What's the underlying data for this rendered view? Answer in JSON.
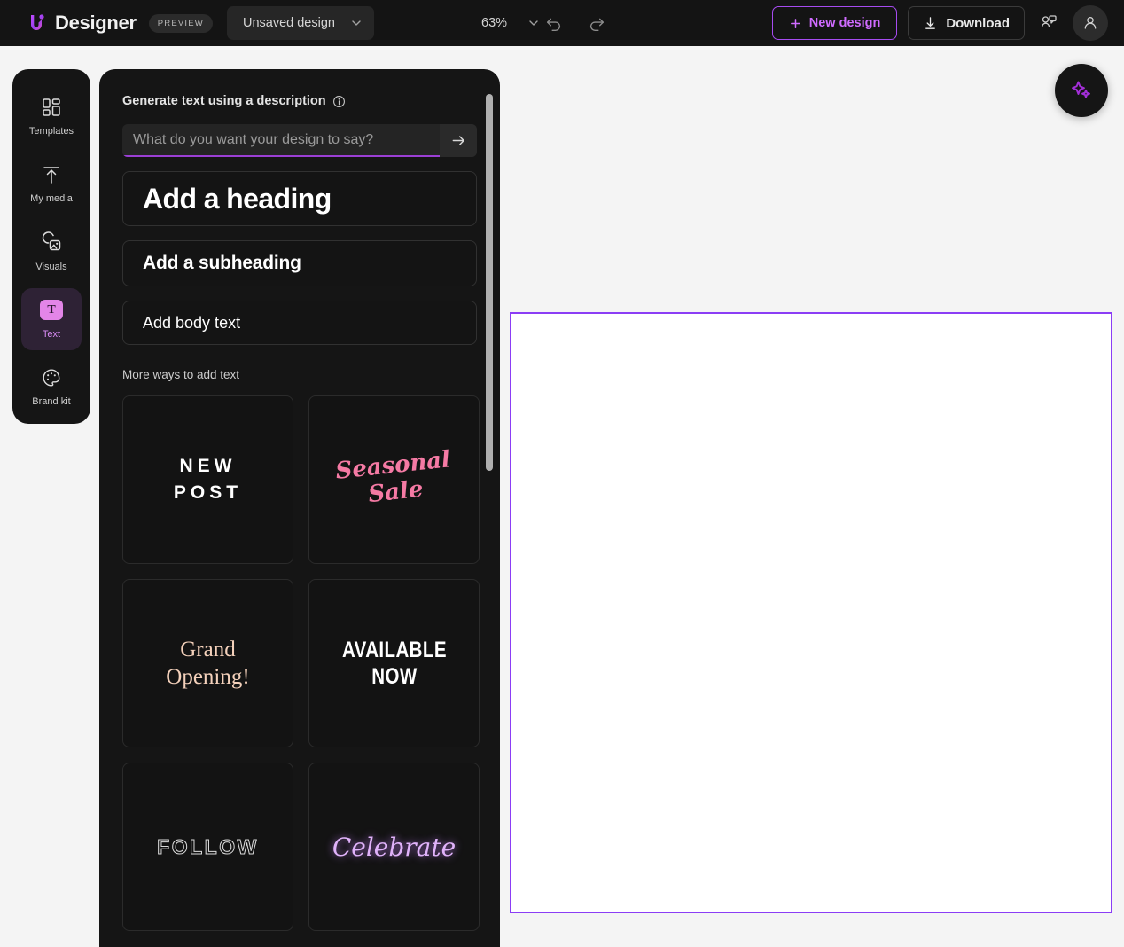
{
  "header": {
    "logo_icon": "designer-logo-icon",
    "app_title": "Designer",
    "preview_badge": "PREVIEW",
    "document_name": "Unsaved design",
    "document_chevron_icon": "chevron-down-icon",
    "zoom_value": "63%",
    "zoom_chevron_icon": "chevron-down-icon",
    "undo_icon": "undo-icon",
    "redo_icon": "redo-icon",
    "new_design_label": "New design",
    "new_design_plus_icon": "plus-icon",
    "download_label": "Download",
    "download_icon": "download-arrow-icon",
    "share_icon": "share-collaborate-icon",
    "avatar_icon": "user-avatar-icon",
    "accent_color": "#cf6bff",
    "background_color": "#141414"
  },
  "sidebar": {
    "items": [
      {
        "label": "Templates",
        "icon": "templates-grid-icon",
        "active": false
      },
      {
        "label": "My media",
        "icon": "upload-arrow-icon",
        "active": false
      },
      {
        "label": "Visuals",
        "icon": "visuals-image-icon",
        "active": false
      },
      {
        "label": "Text",
        "icon": "text-t-icon",
        "active": true
      },
      {
        "label": "Brand kit",
        "icon": "palette-icon",
        "active": false
      }
    ],
    "active_bg_color": "#2e2235",
    "active_label_color": "#d98cf5",
    "text_tile_color": "#e385e8"
  },
  "panel": {
    "generate_label": "Generate text using a description",
    "info_icon": "info-circle-icon",
    "prompt_placeholder": "What do you want your design to say?",
    "prompt_value": "",
    "submit_icon": "arrow-right-icon",
    "focus_underline_color": "#9b3fd4",
    "quick_add": [
      {
        "label": "Add a heading",
        "style": "heading"
      },
      {
        "label": "Add a subheading",
        "style": "subheading"
      },
      {
        "label": "Add body text",
        "style": "body"
      }
    ],
    "more_ways_label": "More ways to add text",
    "templates": [
      {
        "text": "NEW\nPOST",
        "style": "new-post",
        "color": "#ffffff"
      },
      {
        "text": "Seasonal\nSale",
        "style": "seasonal",
        "color": "#f57aa4"
      },
      {
        "text": "Grand\nOpening!",
        "style": "grand",
        "color": "#f4d1bb"
      },
      {
        "text": "AVAILABLE\nNOW",
        "style": "available",
        "color": "#ffffff"
      },
      {
        "text": "FOLLOW",
        "style": "follow",
        "color": "#dcdcdc"
      },
      {
        "text": "Celebrate",
        "style": "celebrate",
        "color": "#e0b2fa"
      }
    ]
  },
  "canvas": {
    "border_color": "#8b3df5",
    "fill_color": "#ffffff",
    "workspace_color": "#f4f4f4"
  },
  "fab": {
    "icon": "sparkle-magic-icon",
    "icon_color": "#a32fd8"
  }
}
